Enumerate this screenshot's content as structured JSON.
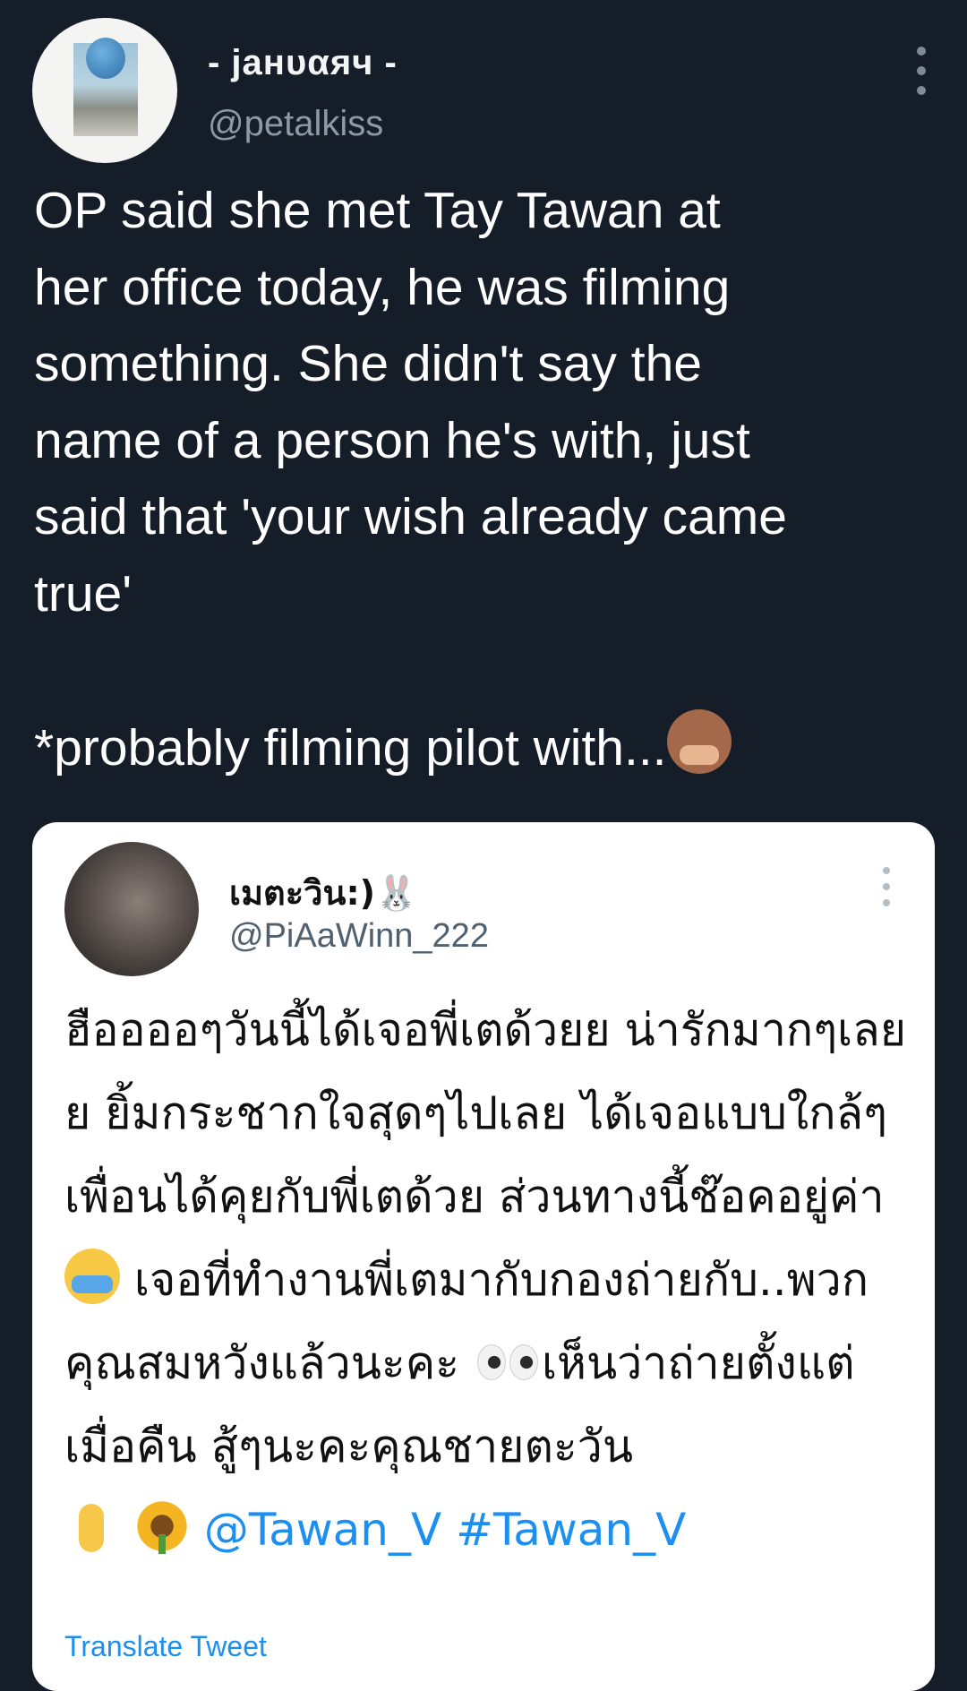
{
  "tweet": {
    "display_name": "- jaнυαяч -",
    "handle": "@petalkiss",
    "text": "OP said she met Tay Tawan at\nher office today, he was filming\nsomething. She didn't say the\nname of a person he's with, just\nsaid that 'your wish already came\ntrue'\n\n*probably filming pilot with...",
    "text_emoji": "speak-no-evil-monkey-icon"
  },
  "quoted": {
    "display_name": "เมตะวิน:)🐰",
    "handle": "@PiAaWinn_222",
    "text_part1": "ฮืออออๆวันนี้ได้เจอพี่เตด้วยย น่ารักมากๆเลยย ยิ้มกระชากใจสุดๆไปเลย ได้เจอแบบใกล้ๆเพื่อนได้คุยกับพี่เตด้วย ส่วนทางนี้ช๊อคอยู่ค่า",
    "text_part2": " เจอที่ทำงานพี่เตมากับกองถ่ายกับ..พวกคุณสมหวังแล้วนะคะ ",
    "text_part3": "เห็นว่าถ่ายตั้งแต่เมื่อคืน สู้ๆนะคะคุณชายตะวัน",
    "mention": "@Tawan_V",
    "hashtag": "#Tawan_V",
    "translate_label": "Translate Tweet"
  }
}
